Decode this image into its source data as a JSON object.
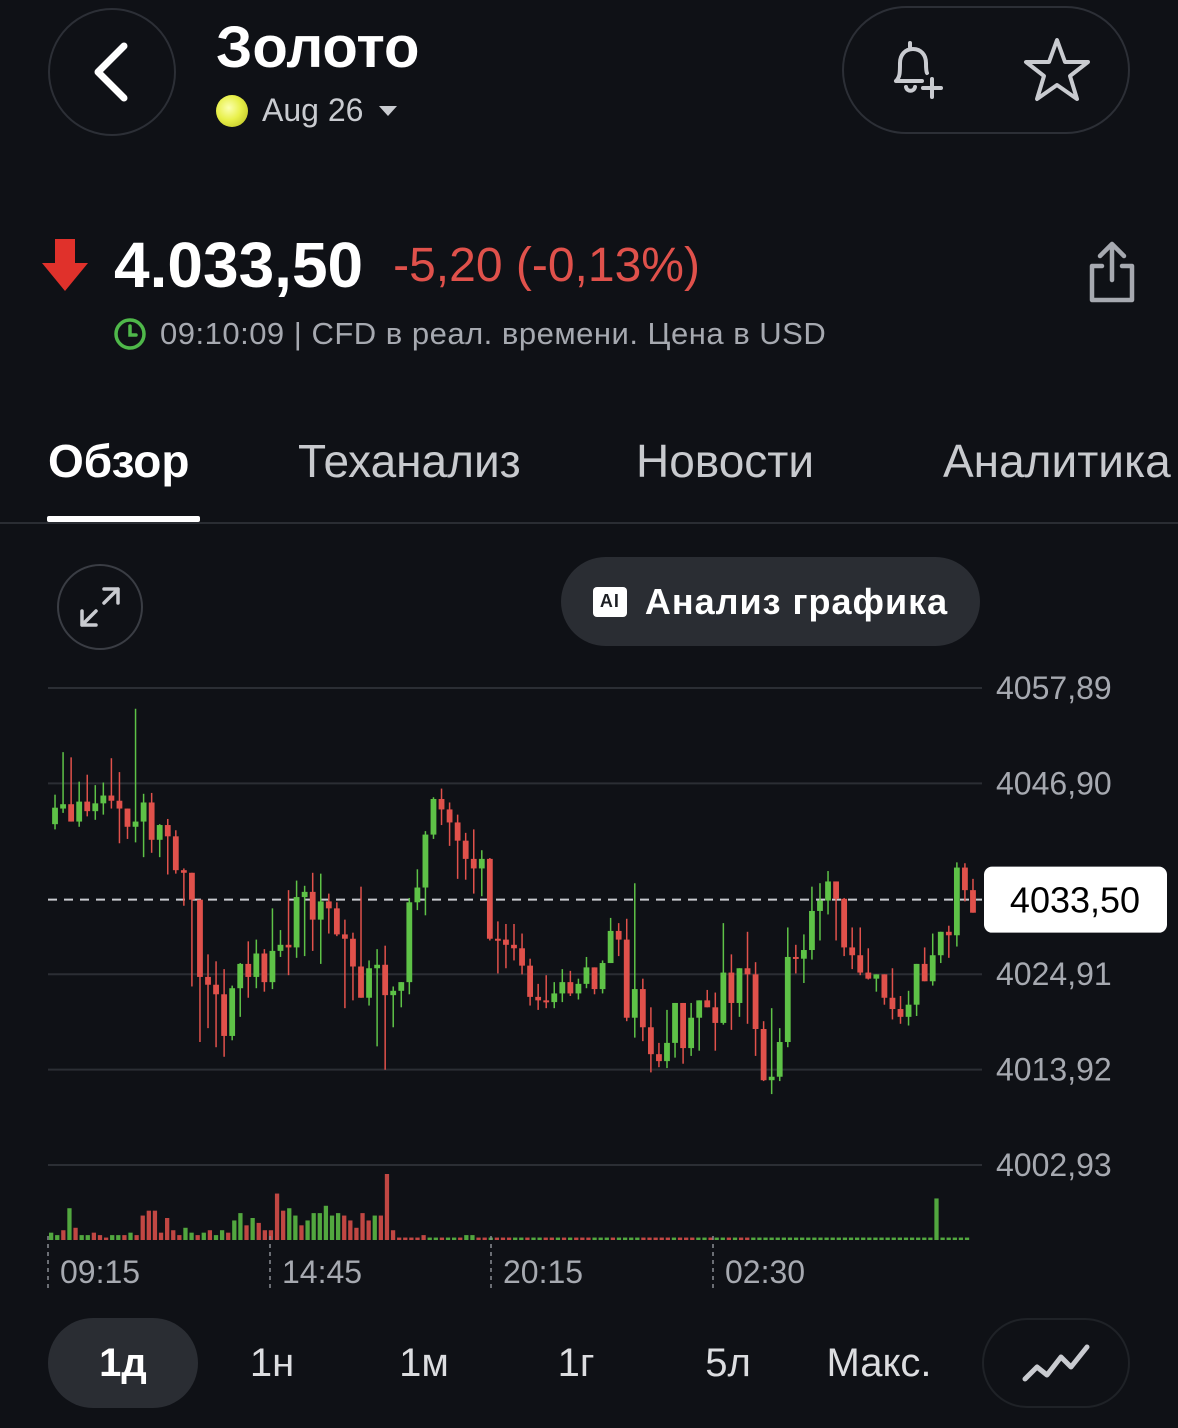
{
  "header": {
    "title": "Золото",
    "contract": "Aug 26",
    "back_icon": "chevron-left-icon",
    "alert_icon": "bell-plus-icon",
    "favorite_icon": "star-icon"
  },
  "quote": {
    "direction": "down",
    "price": "4.033,50",
    "change": "-5,20 (-0,13%)",
    "meta": "09:10:09 | CFD в реал. времени. Цена в USD",
    "colors": {
      "down": "#e0514b",
      "up": "#5ec247",
      "clock": "#4fb84a"
    }
  },
  "tabs": [
    {
      "label": "Обзор",
      "active": true
    },
    {
      "label": "Теханализ",
      "active": false
    },
    {
      "label": "Новости",
      "active": false
    },
    {
      "label": "Аналитика",
      "active": false
    }
  ],
  "chart_toolbar": {
    "ai_button_label": "Анализ графика",
    "ai_badge": "AI"
  },
  "chart_data": {
    "type": "candlestick",
    "y_ticks": [
      "4057,89",
      "4046,90",
      "4024,91",
      "4013,92",
      "4002,93"
    ],
    "ylim": [
      4002.93,
      4057.89
    ],
    "x_ticks": [
      "09:15",
      "14:45",
      "20:15",
      "02:30"
    ],
    "current_price_label": "4033,50",
    "current_price": 4033.5,
    "colors": {
      "up": "#5ec247",
      "down": "#e0514b"
    },
    "candles": [
      [
        4042.2,
        4045.6,
        4041.6,
        4044.1
      ],
      [
        4044.0,
        4050.5,
        4043.5,
        4044.5
      ],
      [
        4044.5,
        4049.9,
        4042.6,
        4042.5
      ],
      [
        4042.5,
        4047.1,
        4041.9,
        4044.8
      ],
      [
        4044.8,
        4047.9,
        4043.1,
        4043.7
      ],
      [
        4043.7,
        4046.7,
        4042.7,
        4044.6
      ],
      [
        4044.6,
        4047.0,
        4043.3,
        4045.5
      ],
      [
        4045.5,
        4049.8,
        4044.0,
        4044.9
      ],
      [
        4044.9,
        4048.2,
        4040.0,
        4044.0
      ],
      [
        4044.0,
        4043.5,
        4040.5,
        4041.9
      ],
      [
        4041.9,
        4055.5,
        4040.1,
        4042.5
      ],
      [
        4042.5,
        4045.7,
        4038.4,
        4044.7
      ],
      [
        4044.7,
        4045.8,
        4038.9,
        4040.4
      ],
      [
        4040.4,
        4042.2,
        4038.4,
        4042.1
      ],
      [
        4042.1,
        4042.8,
        4036.4,
        4040.8
      ],
      [
        4040.8,
        4041.5,
        4036.5,
        4036.9
      ],
      [
        4036.9,
        4037.1,
        4032.8,
        4036.6
      ],
      [
        4036.6,
        4036.2,
        4023.5,
        4033.5
      ],
      [
        4033.5,
        4033.0,
        4017.1,
        4024.6
      ],
      [
        4024.6,
        4027.2,
        4018.7,
        4023.7
      ],
      [
        4023.7,
        4026.4,
        4016.5,
        4022.6
      ],
      [
        4022.6,
        4025.5,
        4015.4,
        4017.8
      ],
      [
        4017.8,
        4023.6,
        4017.3,
        4023.3
      ],
      [
        4023.3,
        4026.2,
        4020.0,
        4026.1
      ],
      [
        4026.1,
        4028.7,
        4022.2,
        4024.6
      ],
      [
        4024.6,
        4028.9,
        4023.3,
        4027.3
      ],
      [
        4027.3,
        4027.8,
        4022.9,
        4024.0
      ],
      [
        4024.0,
        4032.5,
        4023.2,
        4027.6
      ],
      [
        4027.6,
        4030.0,
        4026.9,
        4028.3
      ],
      [
        4028.3,
        4034.6,
        4024.8,
        4028.0
      ],
      [
        4028.0,
        4035.7,
        4026.8,
        4033.8
      ],
      [
        4033.8,
        4035.1,
        4027.0,
        4034.4
      ],
      [
        4034.4,
        4036.6,
        4027.6,
        4031.2
      ],
      [
        4031.2,
        4036.5,
        4026.1,
        4033.3
      ],
      [
        4033.3,
        4034.2,
        4029.6,
        4032.5
      ],
      [
        4032.5,
        4033.2,
        4029.3,
        4029.5
      ],
      [
        4029.5,
        4031.2,
        4021.0,
        4029.0
      ],
      [
        4029.0,
        4029.7,
        4021.9,
        4025.8
      ],
      [
        4025.8,
        4035.0,
        4022.6,
        4022.2
      ],
      [
        4022.2,
        4026.5,
        4021.3,
        4025.6
      ],
      [
        4025.6,
        4027.8,
        4016.6,
        4026.0
      ],
      [
        4026.0,
        4028.2,
        4013.9,
        4022.5
      ],
      [
        4022.5,
        4023.5,
        4018.8,
        4023.0
      ],
      [
        4023.0,
        4023.8,
        4021.1,
        4024.0
      ],
      [
        4024.0,
        4033.7,
        4022.6,
        4033.2
      ],
      [
        4033.2,
        4037.0,
        4032.3,
        4034.9
      ],
      [
        4034.9,
        4041.4,
        4031.7,
        4041.0
      ],
      [
        4041.0,
        4045.3,
        4040.5,
        4045.1
      ],
      [
        4045.1,
        4046.3,
        4042.1,
        4043.9
      ],
      [
        4043.9,
        4044.7,
        4039.7,
        4042.4
      ],
      [
        4042.4,
        4043.3,
        4035.9,
        4040.3
      ],
      [
        4040.3,
        4041.2,
        4035.8,
        4038.2
      ],
      [
        4038.2,
        4041.6,
        4034.2,
        4037.1
      ],
      [
        4037.1,
        4039.2,
        4033.9,
        4038.2
      ],
      [
        4038.2,
        4038.3,
        4028.8,
        4029.0
      ],
      [
        4029.0,
        4031.0,
        4025.0,
        4028.9
      ],
      [
        4028.9,
        4030.7,
        4025.6,
        4028.3
      ],
      [
        4028.3,
        4030.7,
        4026.5,
        4027.9
      ],
      [
        4027.9,
        4029.6,
        4024.9,
        4025.9
      ],
      [
        4025.9,
        4026.7,
        4021.3,
        4022.3
      ],
      [
        4022.3,
        4023.8,
        4020.8,
        4021.9
      ],
      [
        4021.9,
        4024.8,
        4021.0,
        4021.7
      ],
      [
        4021.7,
        4024.0,
        4021.0,
        4022.7
      ],
      [
        4022.7,
        4025.5,
        4021.7,
        4024.0
      ],
      [
        4024.0,
        4025.3,
        4022.4,
        4022.7
      ],
      [
        4022.7,
        4024.4,
        4022.0,
        4023.8
      ],
      [
        4023.8,
        4026.9,
        4023.3,
        4025.7
      ],
      [
        4025.7,
        4025.6,
        4022.6,
        4023.2
      ],
      [
        4023.2,
        4026.5,
        4022.7,
        4026.2
      ],
      [
        4026.2,
        4031.4,
        4026.4,
        4029.9
      ],
      [
        4029.9,
        4030.8,
        4027.0,
        4028.9
      ],
      [
        4028.9,
        4031.3,
        4019.5,
        4019.9
      ],
      [
        4019.9,
        4035.4,
        4017.6,
        4023.2
      ],
      [
        4023.2,
        4024.4,
        4017.2,
        4018.8
      ],
      [
        4018.8,
        4021.1,
        4013.6,
        4015.7
      ],
      [
        4015.7,
        4017.0,
        4014.2,
        4014.9
      ],
      [
        4014.9,
        4020.8,
        4014.1,
        4017.0
      ],
      [
        4017.0,
        4021.3,
        4015.3,
        4021.6
      ],
      [
        4021.6,
        4019.6,
        4014.6,
        4016.4
      ],
      [
        4016.4,
        4021.6,
        4015.5,
        4019.9
      ],
      [
        4019.9,
        4021.5,
        4016.1,
        4021.9
      ],
      [
        4021.9,
        4023.1,
        4021.2,
        4021.1
      ],
      [
        4021.1,
        4022.8,
        4016.1,
        4019.3
      ],
      [
        4019.3,
        4030.8,
        4019.1,
        4025.1
      ],
      [
        4025.1,
        4027.2,
        4018.5,
        4021.6
      ],
      [
        4021.6,
        4024.6,
        4020.0,
        4025.6
      ],
      [
        4025.6,
        4029.8,
        4019.2,
        4024.9
      ],
      [
        4024.9,
        4026.3,
        4015.5,
        4018.6
      ],
      [
        4018.6,
        4019.5,
        4012.6,
        4012.7
      ],
      [
        4012.7,
        4021.0,
        4011.1,
        4013.1
      ],
      [
        4013.1,
        4018.7,
        4012.6,
        4017.1
      ],
      [
        4017.1,
        4030.3,
        4016.5,
        4026.9
      ],
      [
        4026.9,
        4028.3,
        4025.0,
        4026.7
      ],
      [
        4026.7,
        4029.5,
        4023.9,
        4027.7
      ],
      [
        4027.7,
        4035.0,
        4026.6,
        4032.2
      ],
      [
        4032.2,
        4035.4,
        4028.8,
        4033.4
      ],
      [
        4033.4,
        4036.8,
        4031.8,
        4035.6
      ],
      [
        4035.6,
        4034.8,
        4028.8,
        4033.6
      ],
      [
        4033.6,
        4033.7,
        4027.0,
        4028.0
      ],
      [
        4028.0,
        4030.3,
        4025.5,
        4027.1
      ],
      [
        4027.1,
        4030.3,
        4024.8,
        4025.1
      ],
      [
        4025.1,
        4027.9,
        4024.3,
        4024.4
      ],
      [
        4024.4,
        4024.8,
        4022.9,
        4024.9
      ],
      [
        4024.9,
        4024.4,
        4021.4,
        4022.2
      ],
      [
        4022.2,
        4025.6,
        4019.7,
        4020.9
      ],
      [
        4020.9,
        4022.4,
        4019.2,
        4020.0
      ],
      [
        4020.0,
        4023.0,
        4019.0,
        4021.4
      ],
      [
        4021.4,
        4024.2,
        4020.1,
        4026.1
      ],
      [
        4026.1,
        4028.0,
        4024.1,
        4024.1
      ],
      [
        4024.1,
        4029.6,
        4023.6,
        4027.1
      ],
      [
        4027.1,
        4029.3,
        4026.2,
        4029.8
      ],
      [
        4029.8,
        4030.5,
        4026.8,
        4029.4
      ],
      [
        4029.4,
        4037.8,
        4028.1,
        4037.2
      ],
      [
        4037.2,
        4037.7,
        4033.3,
        4034.6
      ],
      [
        4034.6,
        4035.9,
        4032.0,
        4032.0
      ]
    ],
    "volumes": [
      3,
      2,
      4,
      13,
      5,
      2,
      2,
      3,
      2,
      1,
      2,
      2,
      2,
      3,
      2,
      10,
      12,
      12,
      3,
      9,
      4,
      2,
      5,
      3,
      2,
      3,
      4,
      2,
      4,
      3,
      8,
      11,
      6,
      9,
      7,
      4,
      4,
      19,
      12,
      13,
      10,
      6,
      8,
      11,
      11,
      14,
      10,
      11,
      10,
      8,
      5,
      11,
      8,
      10,
      10,
      27,
      4,
      1,
      1,
      1,
      1,
      2,
      1,
      1,
      1,
      1,
      1,
      1,
      2,
      2,
      1,
      1,
      1,
      1,
      1,
      1,
      1,
      1,
      1,
      1,
      1,
      1,
      1,
      1,
      1,
      1,
      1,
      1,
      1,
      1,
      1,
      1,
      1,
      1,
      1,
      1,
      1,
      1,
      1,
      1,
      1,
      1,
      1,
      1,
      1,
      1,
      1,
      1,
      1,
      1,
      1,
      1,
      1,
      1,
      1,
      1,
      1,
      1,
      1,
      1,
      1,
      1,
      1,
      1,
      1,
      1,
      1,
      1,
      1,
      1,
      1,
      1,
      1,
      1,
      1,
      1,
      1,
      1,
      1,
      1,
      1,
      1,
      1,
      1,
      1,
      17,
      1,
      1,
      1,
      1,
      1
    ]
  },
  "timeframes": [
    {
      "label": "1д",
      "active": true
    },
    {
      "label": "1н",
      "active": false
    },
    {
      "label": "1м",
      "active": false
    },
    {
      "label": "1г",
      "active": false
    },
    {
      "label": "5л",
      "active": false
    },
    {
      "label": "Макс.",
      "active": false
    }
  ],
  "chart_type_icon": "line-chart-icon",
  "expand_icon": "expand-icon",
  "share_icon": "share-icon"
}
